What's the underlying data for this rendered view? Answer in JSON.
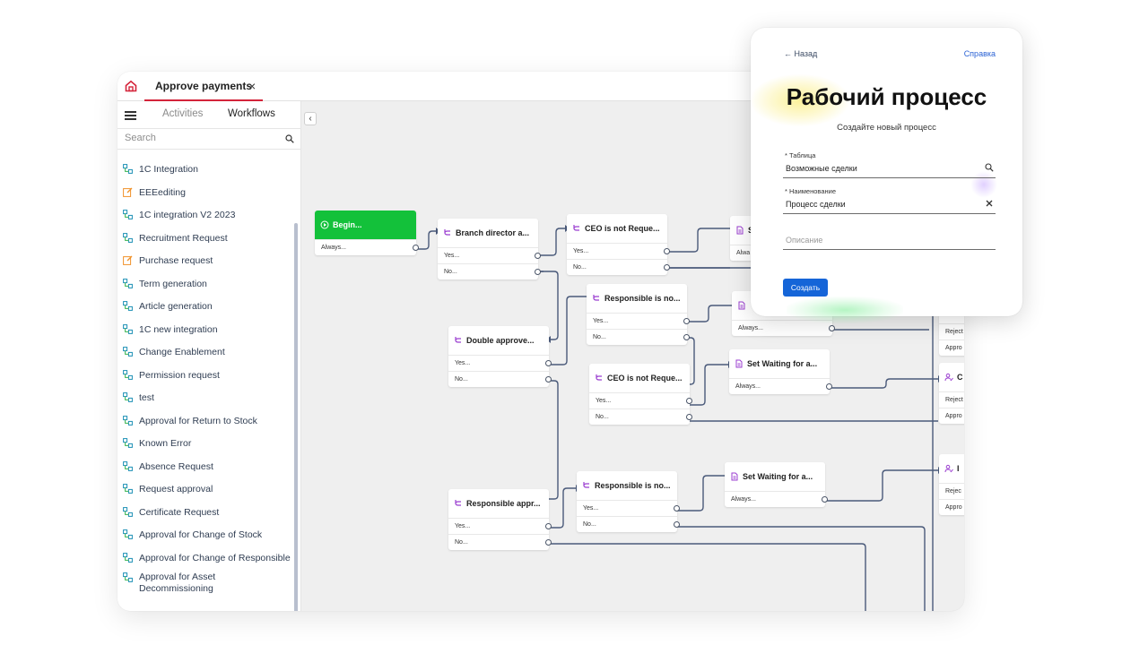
{
  "app": {
    "tab_title": "Approve payments",
    "tab_close": "×",
    "collapse_label": "‹",
    "icons": {
      "home": "home-icon",
      "close": "close-icon",
      "menu": "menu-icon",
      "search": "search-icon",
      "workflow": "workflow-icon",
      "workflow_alt": "edit-workflow-icon"
    },
    "colors": {
      "accent": "#d4243a",
      "begin_node": "#13c13a",
      "wire": "#4a5a7a",
      "primary": "#1565d8"
    }
  },
  "sidebar": {
    "tabs": {
      "activities": "Activities",
      "workflows": "Workflows"
    },
    "search_placeholder": "Search",
    "items": [
      {
        "label": "1C Integration"
      },
      {
        "label": "EEEediting"
      },
      {
        "label": "1C integration V2 2023"
      },
      {
        "label": "Recruitment Request"
      },
      {
        "label": "Purchase request"
      },
      {
        "label": "Term generation"
      },
      {
        "label": "Article generation"
      },
      {
        "label": "1C new integration"
      },
      {
        "label": "Change Enablement"
      },
      {
        "label": "Permission request"
      },
      {
        "label": "test"
      },
      {
        "label": "Approval for Return to Stock"
      },
      {
        "label": "Known Error"
      },
      {
        "label": "Absence Request"
      },
      {
        "label": "Request approval"
      },
      {
        "label": "Certificate Request"
      },
      {
        "label": "Approval for Change of Stock"
      },
      {
        "label": "Approval for Change of Responsible"
      },
      {
        "label": "Approval for Asset Decommissioning"
      }
    ]
  },
  "canvas": {
    "nodes": {
      "begin": {
        "title": "Begin...",
        "rows": [
          "Always..."
        ]
      },
      "branch": {
        "title": "Branch director a...",
        "rows": [
          "Yes...",
          "No..."
        ]
      },
      "ceo1": {
        "title": "CEO is not Reque...",
        "rows": [
          "Yes...",
          "No..."
        ]
      },
      "set_top": {
        "title": "S",
        "rows": [
          "Alwa"
        ]
      },
      "resp1": {
        "title": "Responsible is no...",
        "rows": [
          "Yes...",
          "No..."
        ]
      },
      "set_mid": {
        "title": "",
        "rows": [
          "Always..."
        ]
      },
      "double": {
        "title": "Double approve...",
        "rows": [
          "Yes...",
          "No..."
        ]
      },
      "ceo2": {
        "title": "CEO is not Reque...",
        "rows": [
          "Yes...",
          "No..."
        ]
      },
      "setwait1": {
        "title": "Set Waiting for a...",
        "rows": [
          "Always..."
        ]
      },
      "respappr": {
        "title": "Responsible appr...",
        "rows": [
          "Yes...",
          "No..."
        ]
      },
      "resp2": {
        "title": "Responsible is no...",
        "rows": [
          "Yes...",
          "No..."
        ]
      },
      "setwait2": {
        "title": "Set Waiting for a...",
        "rows": [
          "Always..."
        ]
      },
      "edge1": {
        "title": "",
        "rows": [
          "Reject",
          "Appro"
        ]
      },
      "edge2": {
        "title": "C",
        "rows": [
          "Reject",
          "Appro"
        ]
      },
      "edge3": {
        "title": "I",
        "rows": [
          "Rejec",
          "Appro"
        ]
      }
    }
  },
  "dialog": {
    "back": "← Назад",
    "help": "Справка",
    "title": "Рабочий процесс",
    "subtitle": "Создайте новый процесс",
    "table_label": "* Таблица",
    "table_value": "Возможные сделки",
    "name_label": "* Наименование",
    "name_value": "Процесс сделки",
    "description_placeholder": "Описание",
    "create_button": "Создать",
    "icons": {
      "search": "search-icon",
      "clear": "clear-icon"
    }
  }
}
